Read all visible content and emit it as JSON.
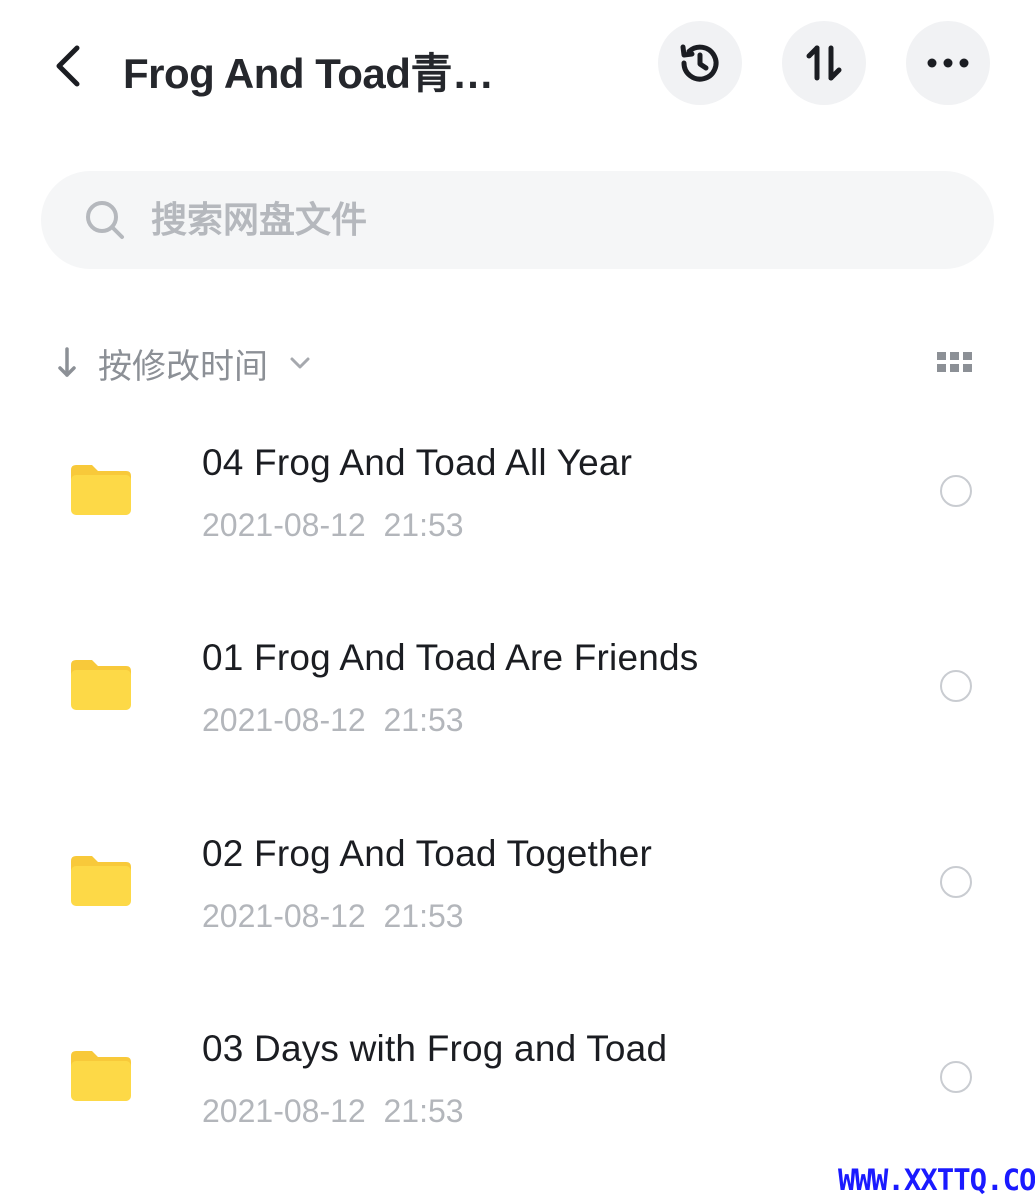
{
  "header": {
    "title": "Frog And Toad青…",
    "back_icon": "chevron-left-icon",
    "history_icon": "history-clock-icon",
    "sort_icon": "sort-arrows-icon",
    "more_icon": "more-dots-icon"
  },
  "search": {
    "placeholder": "搜索网盘文件",
    "icon": "search-icon"
  },
  "sortbar": {
    "label": "按修改时间",
    "arrow_icon": "arrow-down-icon",
    "dropdown_icon": "chevron-down-icon",
    "view_toggle_icon": "grid-view-icon"
  },
  "files": [
    {
      "name": "04 Frog And Toad All Year",
      "date": "2021-08-12  21:53"
    },
    {
      "name": "01 Frog And Toad Are Friends",
      "date": "2021-08-12  21:53"
    },
    {
      "name": "02 Frog And Toad Together",
      "date": "2021-08-12  21:53"
    },
    {
      "name": "03 Days with Frog and Toad",
      "date": "2021-08-12  21:53"
    }
  ],
  "watermark": "WWW.XXTTQ.COM",
  "colors": {
    "folder": "#FDD947",
    "folder_tab": "#F8C93A",
    "button_bg": "#F1F2F4",
    "search_bg": "#F5F6F7",
    "secondary_text": "#B3B6BB",
    "watermark": "#1A1AFF"
  }
}
